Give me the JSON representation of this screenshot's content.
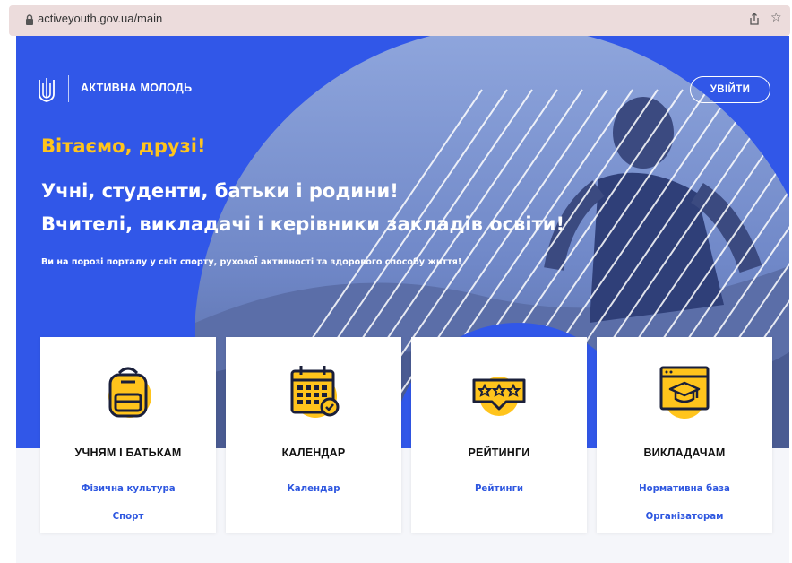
{
  "browser": {
    "url": "activeyouth.gov.ua/main",
    "icons": [
      "lock-icon",
      "share-icon",
      "star-icon"
    ],
    "star_glyph": "☆"
  },
  "header": {
    "brand": "АКТИВНА МОЛОДЬ",
    "login_label": "УВІЙТИ"
  },
  "hero": {
    "greeting": "Вітаємо, друзі!",
    "line1": "Учні, студенти, батьки і родини!",
    "line2": "Вчителі, викладачі і керівники закладів освіти!",
    "subtitle": "Ви на порозі порталу у світ спорту, руховоЇ активності та здорового способу життя!"
  },
  "cards": [
    {
      "title": "УЧНЯМ І БАТЬКАМ",
      "icon": "backpack-icon",
      "links": [
        "Фізична культура",
        "Спорт"
      ]
    },
    {
      "title": "КАЛЕНДАР",
      "icon": "calendar-icon",
      "links": [
        "Календар"
      ]
    },
    {
      "title": "РЕЙТИНГИ",
      "icon": "rating-stars-icon",
      "links": [
        "Рейтинги"
      ]
    },
    {
      "title": "ВИКЛАДАЧАМ",
      "icon": "graduation-cap-icon",
      "links": [
        "Нормативна база",
        "Організаторам"
      ]
    }
  ],
  "colors": {
    "hero_blue": "#3157e8",
    "accent_yellow": "#ffc41c",
    "link_blue": "#2e57e0",
    "icon_dark": "#1a1f3a"
  }
}
